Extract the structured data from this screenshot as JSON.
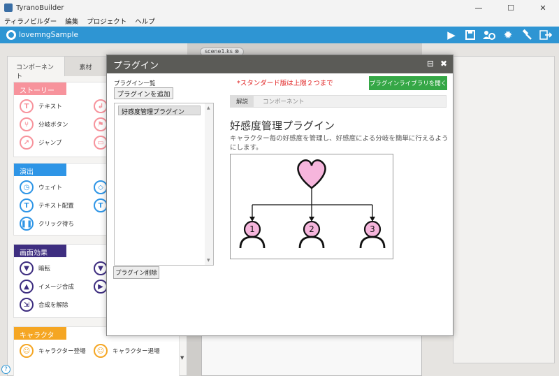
{
  "window": {
    "title": "TyranoBuilder",
    "minimize": "—",
    "maximize": "☐",
    "close": "✕"
  },
  "menu": [
    "ティラノビルダー",
    "編集",
    "プロジェクト",
    "ヘルプ"
  ],
  "toolbar": {
    "project_name": "lovemngSample",
    "icons": [
      "play-icon",
      "save-icon",
      "users-gear-icon",
      "gear-icon",
      "hammer-icon",
      "export-icon"
    ]
  },
  "left_panel": {
    "tabs": [
      "コンポーネント",
      "素材"
    ],
    "categories": [
      {
        "name": "ストーリー",
        "color": "#f7939c",
        "items": [
          "テキスト",
          "分岐ボタン",
          "ジャンプ"
        ]
      },
      {
        "name": "演出",
        "color": "#2e95e6",
        "items": [
          "ウェイト",
          "テキスト配置",
          "クリック待ち"
        ]
      },
      {
        "name": "画面効果",
        "color": "#3e2e80",
        "items": [
          "暗転",
          "イメージ合成",
          "合成を解除"
        ]
      },
      {
        "name": "キャラクター",
        "color": "#f5a623",
        "items": [
          "キャラクター登場",
          "キャラクター退場"
        ]
      }
    ]
  },
  "editor": {
    "file_tab": "scene1.ks"
  },
  "dialog": {
    "title": "プラグイン",
    "list_label": "プラグイン一覧",
    "add_button": "プラグインを追加",
    "plugins": [
      "好感度管理プラグイン"
    ],
    "delete_button": "プラグイン削除",
    "notice": "*スタンダード版は上限２つまで",
    "library_button": "プラグインライブラリを開く",
    "subtabs": [
      "解説",
      "コンポーネント"
    ],
    "plugin_title": "好感度管理プラグイン",
    "plugin_description": "キャラクター毎の好感度を管理し、好感度による分岐を簡単に行えるようにします。",
    "diagram_labels": [
      "1",
      "2",
      "3"
    ]
  },
  "colors": {
    "toolbar": "#2e95d3",
    "dialog_header": "#5b5b57",
    "green_button": "#35a746",
    "heart": "#f6b5dc"
  }
}
